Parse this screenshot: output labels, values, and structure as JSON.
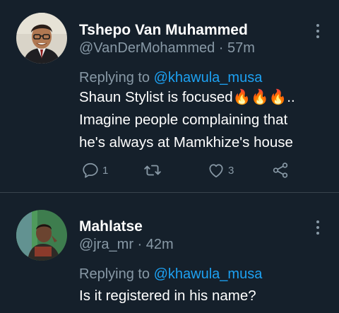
{
  "tweets": [
    {
      "name": "Tshepo Van Muhammed",
      "handle": "@VanDerMohammed",
      "separator": "·",
      "time": "57m",
      "replying_prefix": "Replying to",
      "replying_handle": "@khawula_musa",
      "lines": [
        "Shaun Stylist is focused",
        "Imagine people complaining that",
        "he's always at Mamkhize's house"
      ],
      "line1_suffix": "..",
      "fire_emoji": "🔥",
      "reply_count": "1",
      "retweet_count": "",
      "like_count": "3",
      "avatar_icon": "avatar-photo-icon"
    },
    {
      "name": "Mahlatse",
      "handle": "@jra_mr",
      "separator": "·",
      "time": "42m",
      "replying_prefix": "Replying to",
      "replying_handle": "@khawula_musa",
      "lines": [
        "Is it registered in his name?"
      ],
      "avatar_icon": "avatar-photo-icon"
    }
  ],
  "colors": {
    "background": "#15202b",
    "secondary_text": "#8899a6",
    "link": "#1da1f2",
    "divider": "#38444d"
  }
}
